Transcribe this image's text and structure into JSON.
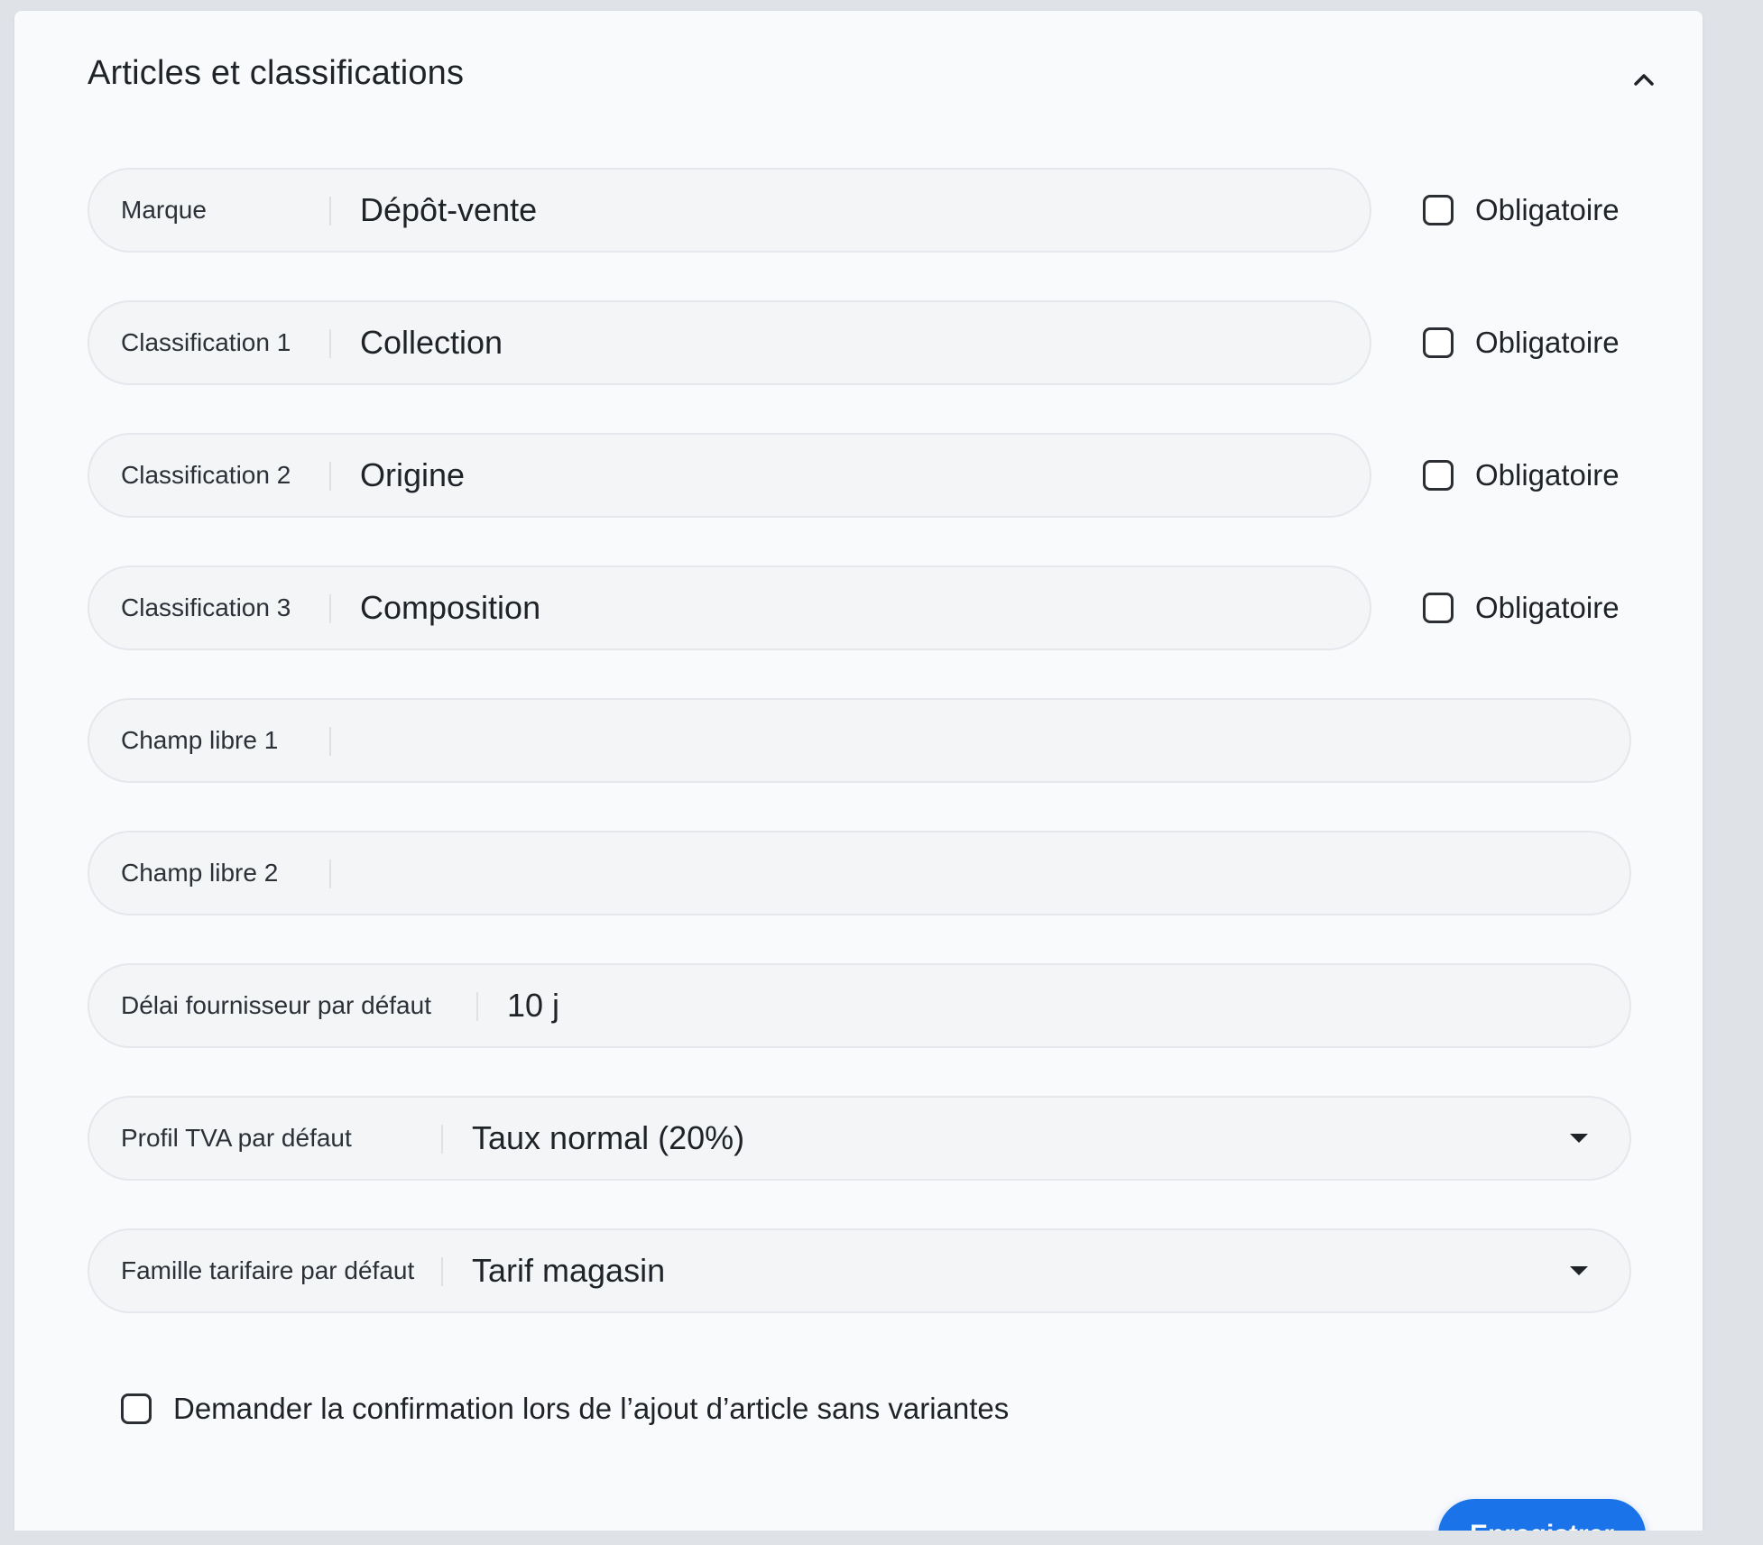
{
  "section": {
    "title": "Articles et classifications",
    "collapse_icon": "chevron-up-icon"
  },
  "fields": [
    {
      "label": "Marque",
      "value": "Dépôt-vente",
      "required_label": "Obligatoire",
      "required_checked": false
    },
    {
      "label": "Classification 1",
      "value": "Collection",
      "required_label": "Obligatoire",
      "required_checked": false
    },
    {
      "label": "Classification 2",
      "value": "Origine",
      "required_label": "Obligatoire",
      "required_checked": false
    },
    {
      "label": "Classification 3",
      "value": "Composition",
      "required_label": "Obligatoire",
      "required_checked": false
    },
    {
      "label": "Champ libre 1",
      "value": ""
    },
    {
      "label": "Champ libre 2",
      "value": ""
    },
    {
      "label": "Délai fournisseur par défaut",
      "value": "10 j"
    },
    {
      "label": "Profil TVA par défaut",
      "value": "Taux normal (20%)",
      "type": "select",
      "icon": "caret-down-icon"
    },
    {
      "label": "Famille tarifaire par défaut",
      "value": "Tarif magasin",
      "type": "select",
      "icon": "caret-down-icon"
    }
  ],
  "confirm": {
    "label": "Demander la confirmation lors de l’ajout d’article sans variantes",
    "checked": false
  },
  "save_button": {
    "label": "Enregistrer",
    "color": "#1a73e8"
  }
}
